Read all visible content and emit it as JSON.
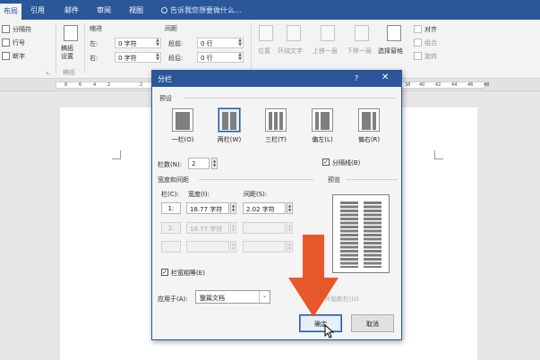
{
  "ribbon_tabs": {
    "layout": "布局",
    "references": "引用",
    "mailings": "邮件",
    "review": "审阅",
    "view": "视图",
    "tell_me": "告诉我您想要做什么..."
  },
  "ribbon": {
    "breaks": "分隔符",
    "line_numbers": "行号",
    "hyphenation": "断字",
    "page_setup_expander": "⌞",
    "paper_settings": "稿纸\n设置",
    "paper_group": "稿纸",
    "indent_header": "缩进",
    "spacing_header": "间距",
    "indent_left_label": "左:",
    "indent_left_value": "0 字符",
    "indent_right_label": "右:",
    "indent_right_value": "0 字符",
    "spacing_before_label": "段前:",
    "spacing_before_value": "0 行",
    "spacing_after_label": "段后:",
    "spacing_after_value": "0 行",
    "position": "位置",
    "wrap_text": "环绕文字",
    "bring_forward": "上移一层",
    "send_backward": "下移一层",
    "selection_pane": "选择窗格",
    "align": "对齐",
    "group": "组合",
    "rotate": "旋转"
  },
  "ruler": {
    "left_numbers": [
      "8",
      "6",
      "4",
      "2",
      "2"
    ],
    "right_numbers": [
      "38",
      "40",
      "42",
      "44",
      "46",
      "48"
    ]
  },
  "dialog": {
    "title": "分栏",
    "help": "?",
    "close": "✕",
    "presets_label": "预设",
    "presets": [
      {
        "label": "一栏(O)",
        "cols": 1
      },
      {
        "label": "两栏(W)",
        "cols": 2
      },
      {
        "label": "三栏(T)",
        "cols": 3
      },
      {
        "label": "偏左(L)",
        "cols": 2
      },
      {
        "label": "偏右(R)",
        "cols": 2
      }
    ],
    "num_columns_label": "栏数(N):",
    "num_columns_value": "2",
    "line_between_label": "分隔线(B)",
    "line_between_checked": "✓",
    "width_spacing_label": "宽度和间距",
    "preview_label": "预览",
    "col_header": "栏(C):",
    "width_header": "宽度(I):",
    "spacing_header": "间距(S):",
    "rows": [
      {
        "num": "1:",
        "width": "18.77 字符",
        "spacing": "2.02 字符"
      },
      {
        "num": "2:",
        "width": "18.77 字符",
        "spacing": ""
      },
      {
        "num": "",
        "width": "",
        "spacing": ""
      }
    ],
    "equal_width_label": "栏宽相等(E)",
    "equal_width_checked": "✓",
    "apply_to_label": "应用于(A):",
    "apply_to_value": "整篇文档",
    "start_new_column_label": "开始新栏(U)",
    "ok": "确定",
    "cancel": "取消"
  },
  "colors": {
    "accent": "#2b579a",
    "arrow": "#e8572a"
  }
}
